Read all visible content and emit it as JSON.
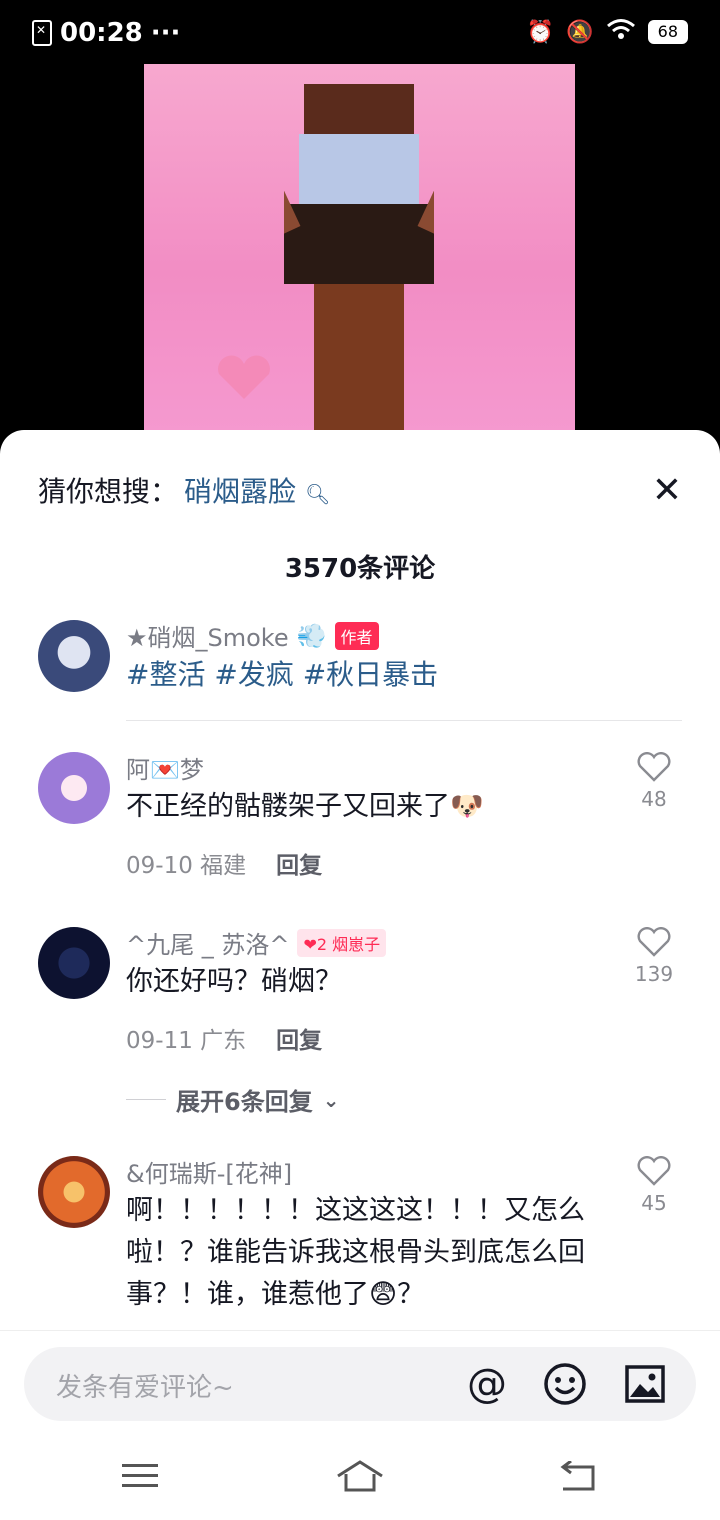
{
  "status": {
    "time": "00:28",
    "dots": "···",
    "battery": "68"
  },
  "sheet": {
    "suggest_label": "猜你想搜：",
    "suggest_keyword": "硝烟露脸",
    "comment_count": "3570条评论"
  },
  "comments": [
    {
      "user": "★硝烟_Smoke",
      "badge": "作者",
      "text": "#整活 #发疯 #秋日暴击"
    },
    {
      "user": "阿💌梦",
      "text": "不正经的骷髅架子又回来了🐶",
      "date": "09-10",
      "loc": "福建",
      "reply": "回复",
      "likes": "48"
    },
    {
      "user": "^九尾 _ 苏洛^",
      "badge": "烟崽子",
      "badge_level": "2",
      "text": "你还好吗？硝烟？",
      "date": "09-11",
      "loc": "广东",
      "reply": "回复",
      "likes": "139",
      "expand": "展开6条回复"
    },
    {
      "user": "&何瑞斯-[花神]",
      "text": "啊！！！！！！这这这这！！！又怎么啦！？谁能告诉我这根骨头到底怎么回事？！谁，谁惹他了😨？",
      "likes": "45"
    }
  ],
  "input": {
    "placeholder": "发条有爱评论~"
  }
}
